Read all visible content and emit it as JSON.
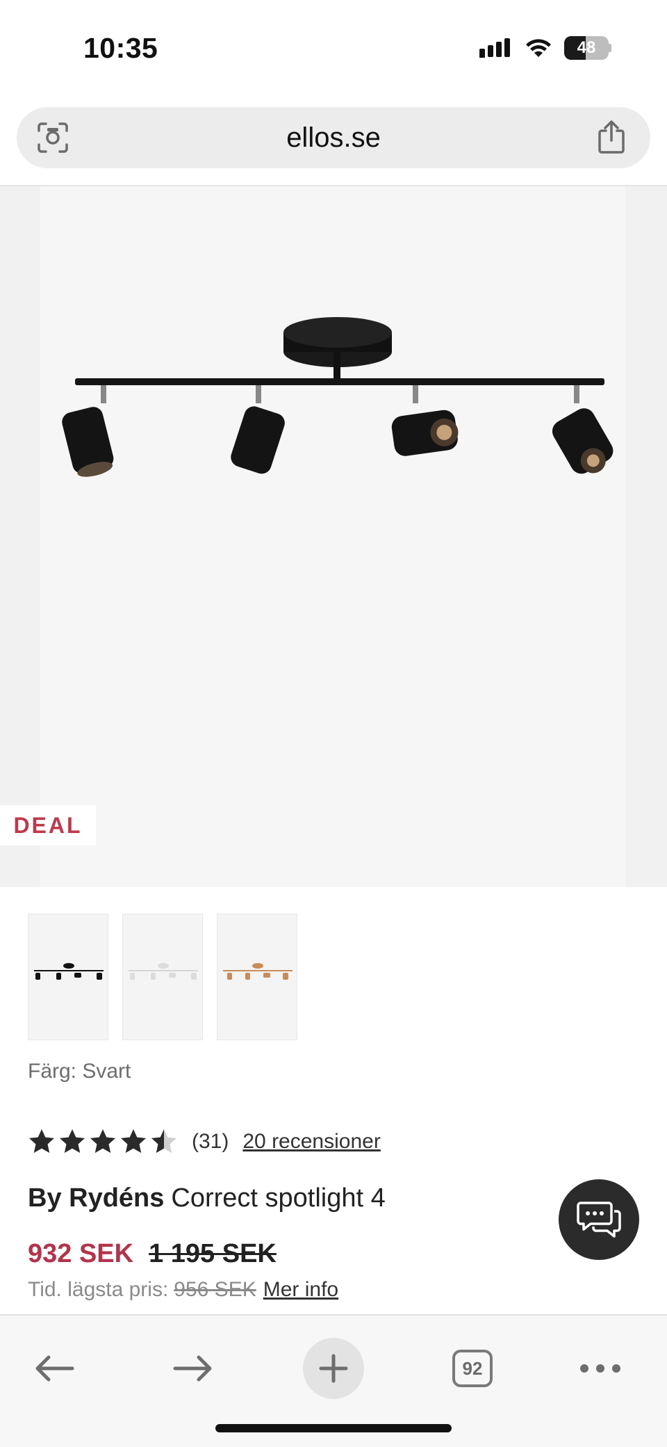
{
  "status_bar": {
    "time": "10:35",
    "battery_level": "48",
    "battery_fraction": 0.48,
    "icons": [
      "signal-icon",
      "wifi-icon",
      "battery-icon"
    ]
  },
  "browser": {
    "url": "ellos.se",
    "left_icon": "screen-search-icon",
    "right_icon": "share-icon"
  },
  "product": {
    "badge": "DEAL",
    "color_label": "Färg: Svart",
    "rating": 4.5,
    "rating_count": "(31)",
    "reviews_link": "20 recensioner",
    "brand": "By Rydéns",
    "name": "Correct spotlight 4",
    "sale_price": "932 SEK",
    "original_price": "1 195 SEK",
    "lowest_price_label": "Tid. lägsta pris:",
    "lowest_price": "956 SEK",
    "more_info": "Mer info",
    "thumbnails": [
      {
        "variant": "black",
        "color": "#111111"
      },
      {
        "variant": "white",
        "color": "#dcdcdc"
      },
      {
        "variant": "copper",
        "color": "#c98b5a"
      }
    ]
  },
  "colors": {
    "sale": "#b3344a",
    "deal": "#c0394b",
    "chat_bg": "#2b2b2b"
  },
  "toolbar": {
    "tabs_count": "92",
    "items": [
      "back-icon",
      "forward-icon",
      "new-tab-icon",
      "tabs-icon",
      "more-icon"
    ]
  }
}
